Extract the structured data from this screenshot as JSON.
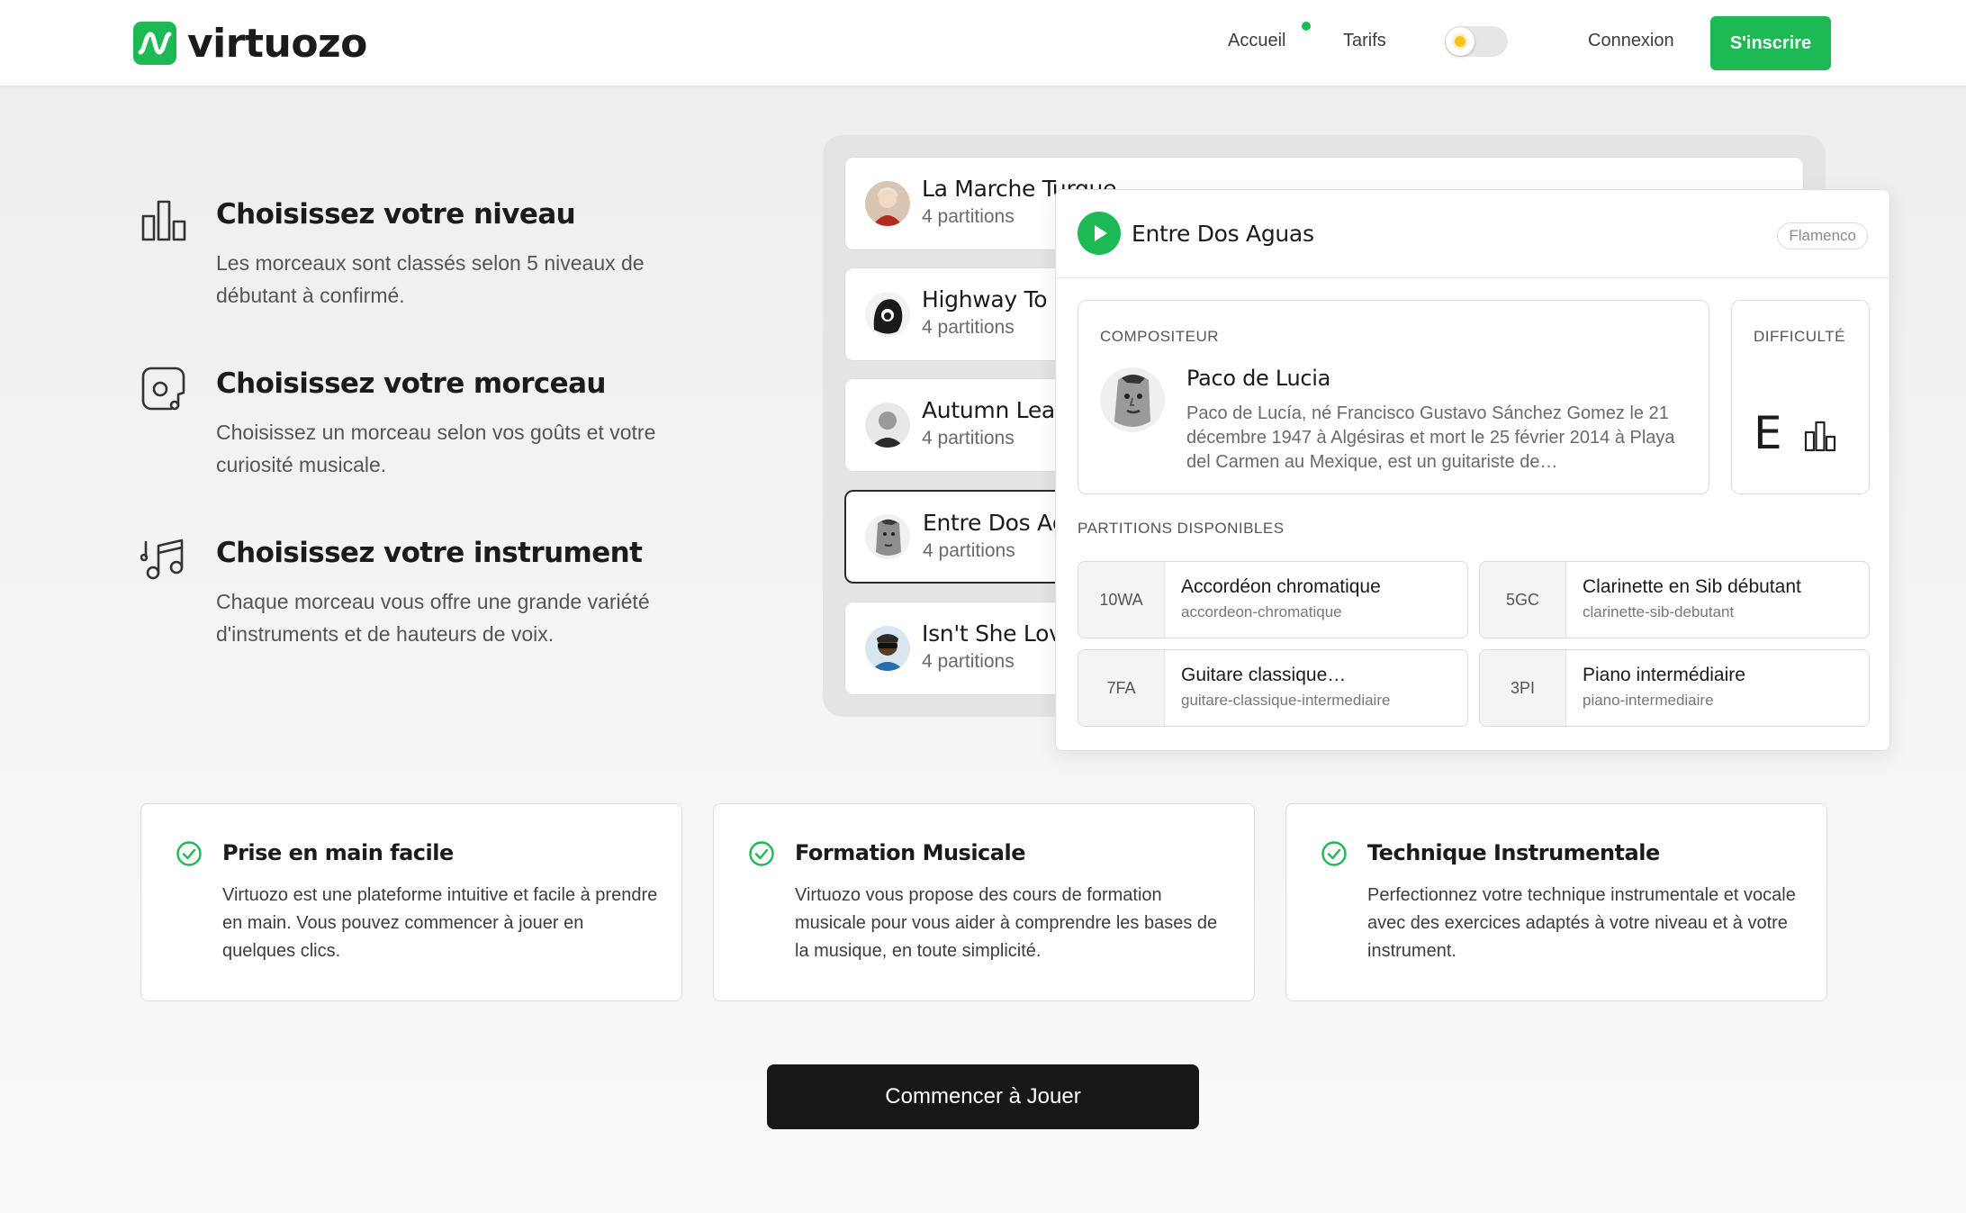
{
  "header": {
    "logo_text": "virtuozo",
    "nav": {
      "accueil": "Accueil",
      "tarifs": "Tarifs",
      "connexion": "Connexion"
    },
    "signup_label": "S'inscrire"
  },
  "features": [
    {
      "title": "Choisissez votre niveau",
      "description": "Les morceaux sont classés selon 5 niveaux de débutant à confirmé.",
      "icon": "bar-chart-icon"
    },
    {
      "title": "Choisissez votre morceau",
      "description": "Choisissez un morceau selon vos goûts et votre curiosité musicale.",
      "icon": "music-app-icon"
    },
    {
      "title": "Choisissez votre instrument",
      "description": "Chaque morceau vous offre une grande variété d'instruments et de hauteurs de voix.",
      "icon": "music-notes-icon"
    }
  ],
  "songs": [
    {
      "title": "La Marche Turque",
      "count": "4 partitions"
    },
    {
      "title": "Highway To Hell",
      "count": "4 partitions"
    },
    {
      "title": "Autumn Leaves",
      "count": "4 partitions"
    },
    {
      "title": "Entre Dos Aguas",
      "count": "4 partitions",
      "selected": true
    },
    {
      "title": "Isn't She Lovely",
      "count": "4 partitions"
    }
  ],
  "detail": {
    "title": "Entre Dos Aguas",
    "genre": "Flamenco",
    "composer_label": "COMPOSITEUR",
    "composer_name": "Paco de Lucia",
    "composer_bio": "Paco de Lucía, né Francisco Gustavo Sánchez Gomez le 21 décembre 1947 à Algésiras et mort le 25 février 2014 à Playa del Carmen au Mexique, est un guitariste de…",
    "difficulty_label": "DIFFICULTÉ",
    "difficulty_value": "E",
    "partitions_label": "PARTITIONS DISPONIBLES",
    "partitions": [
      {
        "code": "10WA",
        "name": "Accordéon chromatique",
        "slug": "accordeon-chromatique"
      },
      {
        "code": "5GC",
        "name": "Clarinette en Sib débutant",
        "slug": "clarinette-sib-debutant"
      },
      {
        "code": "7FA",
        "name": "Guitare classique…",
        "slug": "guitare-classique-intermediaire"
      },
      {
        "code": "3PI",
        "name": "Piano intermédiaire",
        "slug": "piano-intermediaire"
      }
    ]
  },
  "cards": [
    {
      "title": "Prise en main facile",
      "description": "Virtuozo est une plateforme intuitive et facile à prendre en main. Vous pouvez commencer à jouer en quelques clics."
    },
    {
      "title": "Formation Musicale",
      "description": "Virtuozo vous propose des cours de formation musicale pour vous aider à comprendre les bases de la musique, en toute simplicité."
    },
    {
      "title": "Technique Instrumentale",
      "description": "Perfectionnez votre technique instrumentale et vocale avec des exercices adaptés à votre niveau et à votre instrument."
    }
  ],
  "cta_label": "Commencer à Jouer",
  "colors": {
    "brand": "#1db954",
    "dark": "#171717"
  }
}
